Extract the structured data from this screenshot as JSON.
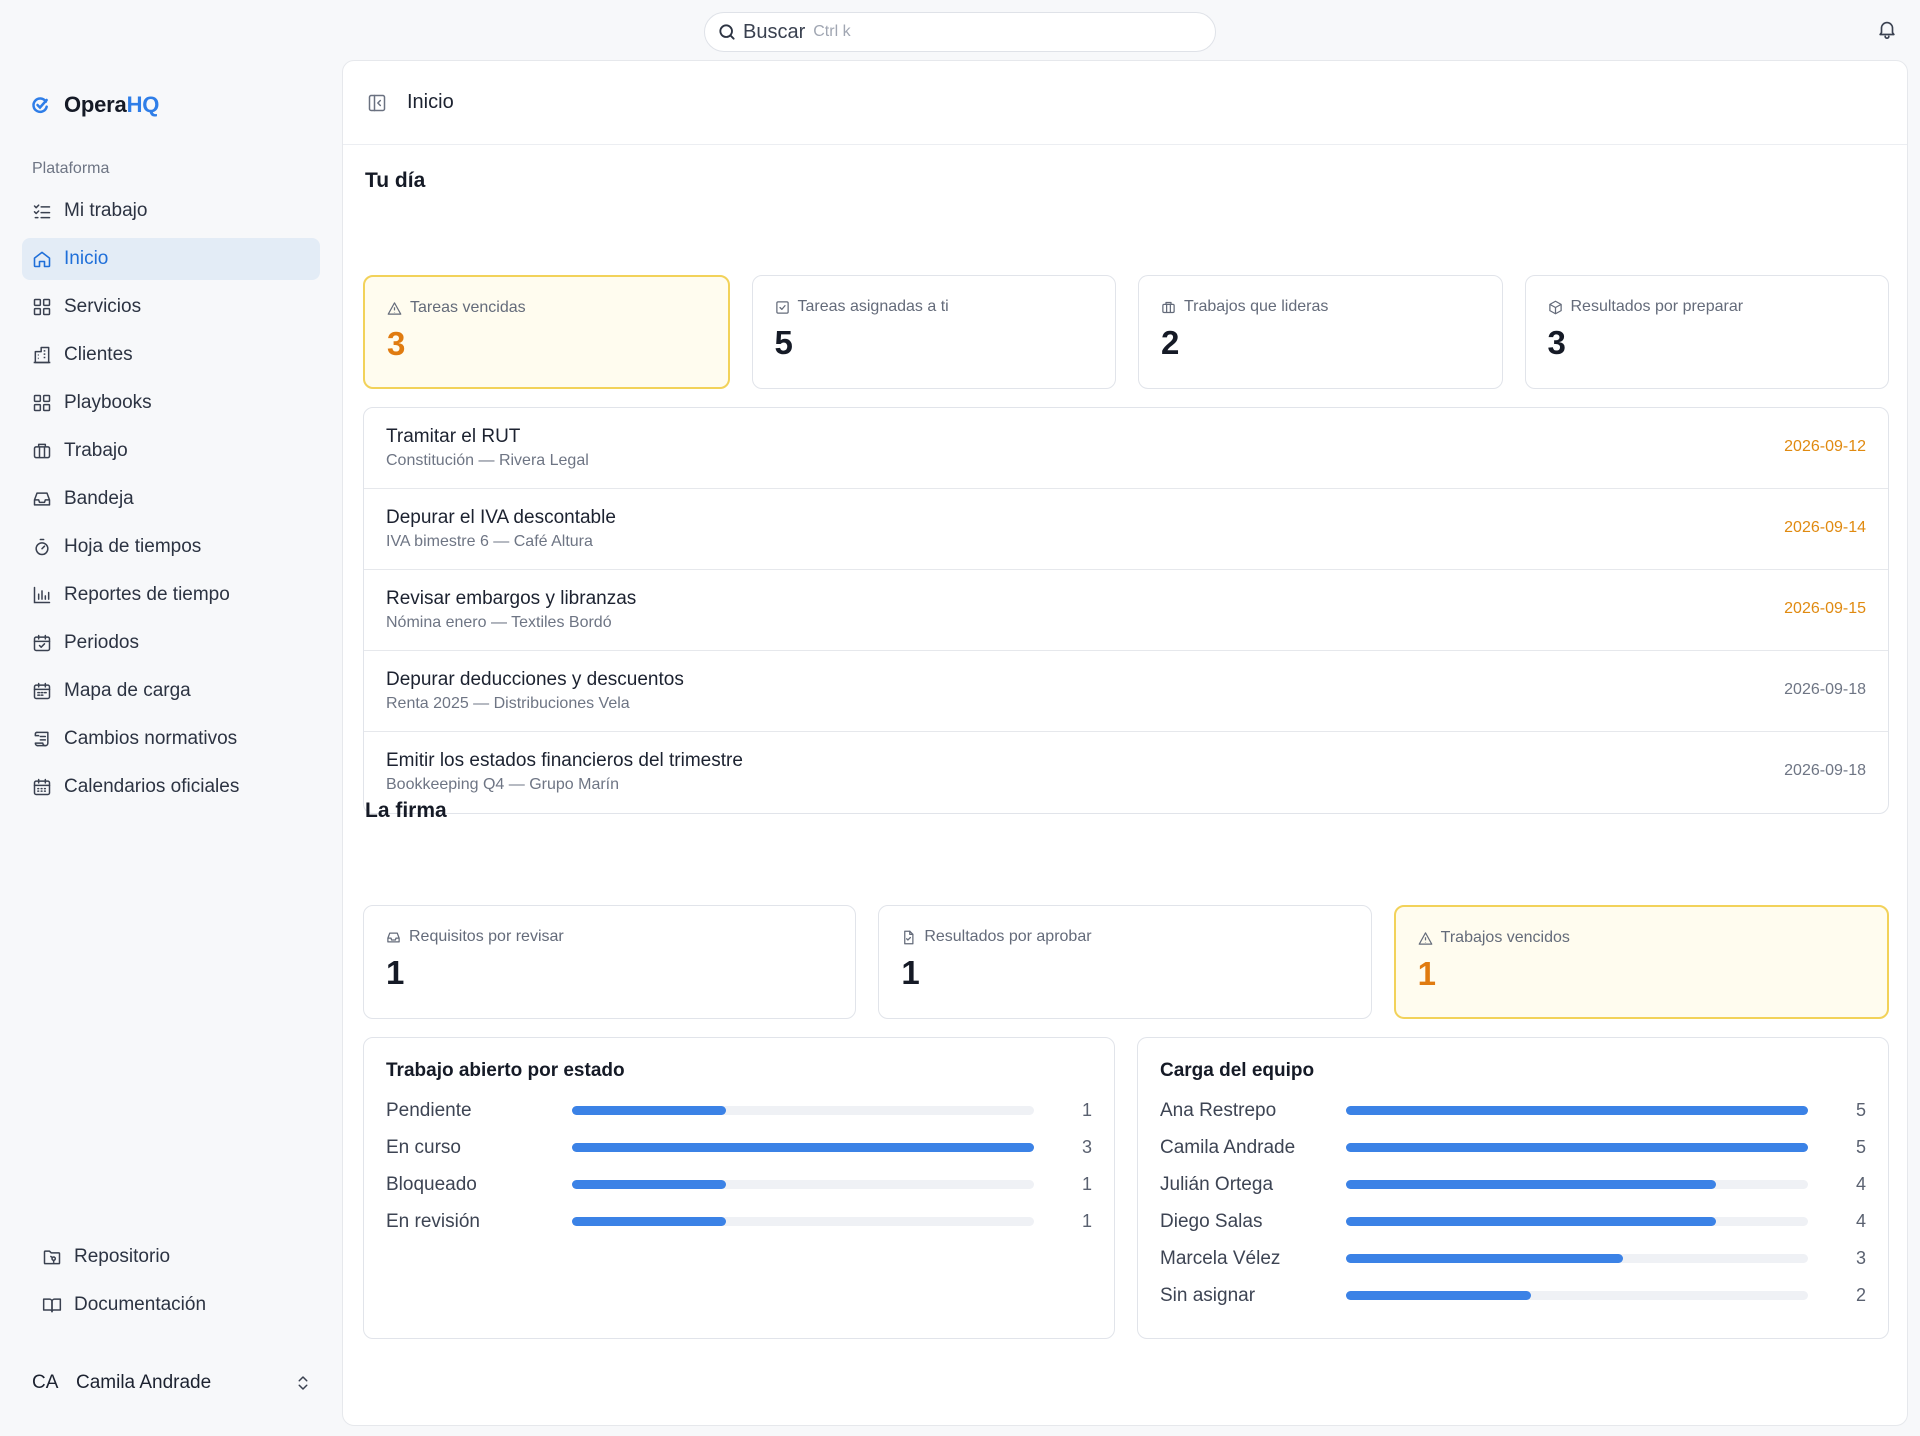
{
  "topbar": {
    "search_label": "Buscar",
    "search_shortcut": "Ctrl k"
  },
  "sidebar": {
    "brand_main": "Opera",
    "brand_accent": "HQ",
    "section_label": "Plataforma",
    "items": [
      {
        "label": "Mi trabajo",
        "icon": "list-check-icon"
      },
      {
        "label": "Inicio",
        "icon": "home-icon",
        "active": true
      },
      {
        "label": "Servicios",
        "icon": "grid-icon"
      },
      {
        "label": "Clientes",
        "icon": "building-icon"
      },
      {
        "label": "Playbooks",
        "icon": "grid-icon"
      },
      {
        "label": "Trabajo",
        "icon": "briefcase-icon"
      },
      {
        "label": "Bandeja",
        "icon": "inbox-icon"
      },
      {
        "label": "Hoja de tiempos",
        "icon": "timer-icon"
      },
      {
        "label": "Reportes de tiempo",
        "icon": "bar-chart-icon"
      },
      {
        "label": "Periodos",
        "icon": "calendar-check-icon"
      },
      {
        "label": "Mapa de carga",
        "icon": "calendar-grid-icon"
      },
      {
        "label": "Cambios normativos",
        "icon": "scroll-icon"
      },
      {
        "label": "Calendarios oficiales",
        "icon": "calendar-icon"
      }
    ],
    "footer_links": [
      {
        "label": "Repositorio",
        "icon": "folder-git-icon"
      },
      {
        "label": "Documentación",
        "icon": "book-icon"
      }
    ],
    "user": {
      "initials": "CA",
      "name": "Camila Andrade"
    }
  },
  "main": {
    "header_title": "Inicio",
    "tu_dia": {
      "title": "Tu día",
      "stats": [
        {
          "label": "Tareas vencidas",
          "value": "3",
          "warn": true,
          "icon": "alert-triangle-icon"
        },
        {
          "label": "Tareas asignadas a ti",
          "value": "5",
          "warn": false,
          "icon": "checkbox-icon"
        },
        {
          "label": "Trabajos que lideras",
          "value": "2",
          "warn": false,
          "icon": "briefcase-icon"
        },
        {
          "label": "Resultados por preparar",
          "value": "3",
          "warn": false,
          "icon": "package-icon"
        }
      ],
      "tasks": [
        {
          "title": "Tramitar el RUT",
          "subtitle": "Constitución — Rivera Legal",
          "date": "2026-09-12",
          "warn": true
        },
        {
          "title": "Depurar el IVA descontable",
          "subtitle": "IVA bimestre 6 — Café Altura",
          "date": "2026-09-14",
          "warn": true
        },
        {
          "title": "Revisar embargos y libranzas",
          "subtitle": "Nómina enero — Textiles Bordó",
          "date": "2026-09-15",
          "warn": true
        },
        {
          "title": "Depurar deducciones y descuentos",
          "subtitle": "Renta 2025 — Distribuciones Vela",
          "date": "2026-09-18",
          "warn": false
        },
        {
          "title": "Emitir los estados financieros del trimestre",
          "subtitle": "Bookkeeping Q4 — Grupo Marín",
          "date": "2026-09-18",
          "warn": false
        }
      ]
    },
    "la_firma": {
      "title": "La firma",
      "stats": [
        {
          "label": "Requisitos por revisar",
          "value": "1",
          "warn": false,
          "icon": "inbox-icon"
        },
        {
          "label": "Resultados por aprobar",
          "value": "1",
          "warn": false,
          "icon": "file-check-icon"
        },
        {
          "label": "Trabajos vencidos",
          "value": "1",
          "warn": true,
          "icon": "alert-triangle-icon"
        }
      ]
    },
    "estado_panel": {
      "title": "Trabajo abierto por estado",
      "max": 3,
      "rows": [
        {
          "label": "Pendiente",
          "value": 1
        },
        {
          "label": "En curso",
          "value": 3
        },
        {
          "label": "Bloqueado",
          "value": 1
        },
        {
          "label": "En revisión",
          "value": 1
        }
      ]
    },
    "carga_panel": {
      "title": "Carga del equipo",
      "max": 5,
      "rows": [
        {
          "label": "Ana Restrepo",
          "value": 5
        },
        {
          "label": "Camila Andrade",
          "value": 5
        },
        {
          "label": "Julián Ortega",
          "value": 4
        },
        {
          "label": "Diego Salas",
          "value": 4
        },
        {
          "label": "Marcela Vélez",
          "value": 3
        },
        {
          "label": "Sin asignar",
          "value": 2
        }
      ]
    }
  },
  "colors": {
    "accent": "#2f7ee8",
    "bar": "#3b82e6",
    "warn_value": "#e07b10",
    "warn_border": "#f2d25a",
    "warn_bg": "#fffcef",
    "active_nav_bg": "#e3ecf6"
  }
}
